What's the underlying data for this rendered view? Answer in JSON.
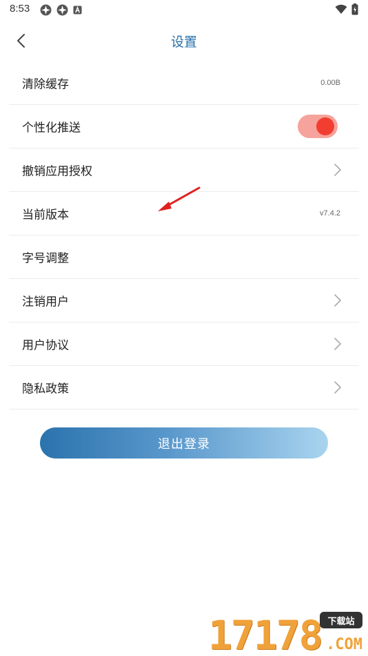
{
  "status_bar": {
    "time": "8:53",
    "left_icons": [
      "notification-app-icon",
      "notification-app-icon",
      "keyboard-a-icon"
    ],
    "right_icons": [
      "wifi-icon",
      "battery-charging-icon"
    ]
  },
  "header": {
    "back_icon": "chevron-left-icon",
    "title": "设置"
  },
  "settings": [
    {
      "label": "清除缓存",
      "value": "0.00B"
    },
    {
      "label": "个性化推送",
      "toggle": true
    },
    {
      "label": "撤销应用授权",
      "chevron": true
    },
    {
      "label": "当前版本",
      "value": "v7.4.2"
    },
    {
      "label": "字号调整"
    },
    {
      "label": "注销用户",
      "chevron": true
    },
    {
      "label": "用户协议",
      "chevron": true
    },
    {
      "label": "隐私政策",
      "chevron": true
    }
  ],
  "logout": {
    "label": "退出登录"
  },
  "annotation": {
    "icon": "red-arrow-icon",
    "color": "#e02020"
  },
  "colors": {
    "accent": "#2a6fa8",
    "toggle_track": "#f5a39c",
    "toggle_knob": "#f23e30"
  },
  "watermark": {
    "number": "17178",
    "badge": "下载站",
    "suffix": ".COM"
  }
}
